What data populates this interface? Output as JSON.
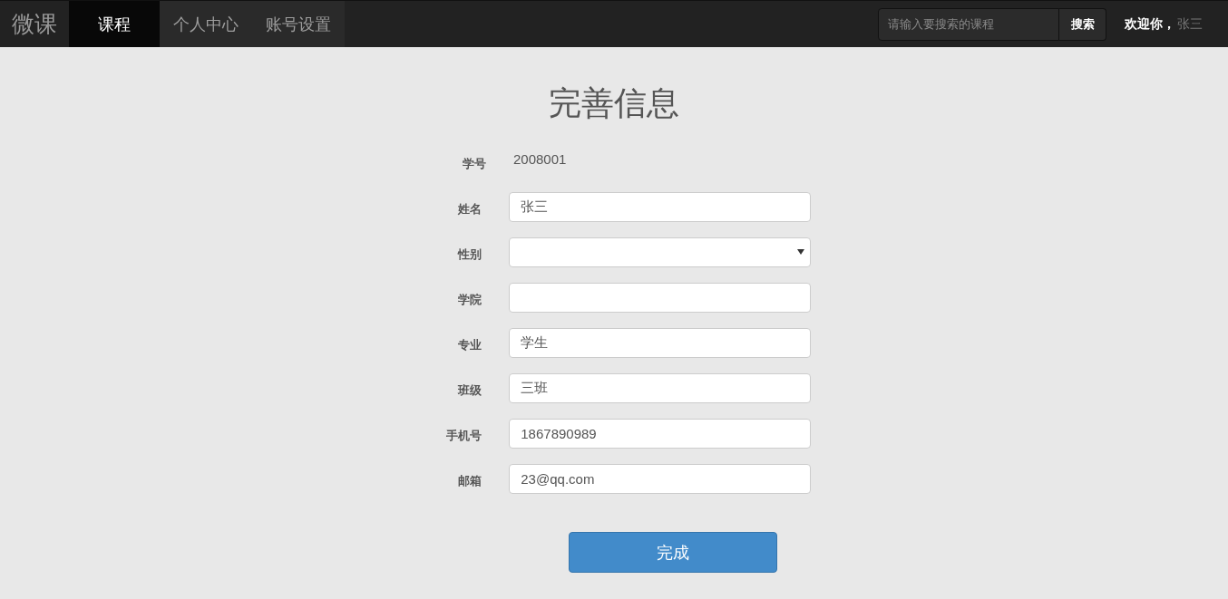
{
  "navbar": {
    "brand": "微课",
    "tabs": [
      {
        "label": "课程",
        "selected": true
      },
      {
        "label": "个人中心",
        "selected": false
      },
      {
        "label": "账号设置",
        "selected": false
      }
    ],
    "search": {
      "placeholder": "请输入要搜索的课程",
      "button": "搜索"
    },
    "welcome": {
      "greeting": "欢迎你，",
      "user": "张三"
    }
  },
  "form": {
    "title": "完善信息",
    "fields": [
      {
        "kind": "static",
        "label": "学号",
        "value": "2008001"
      },
      {
        "kind": "input",
        "label": "姓名",
        "value": "张三"
      },
      {
        "kind": "select",
        "label": "性别"
      },
      {
        "kind": "input",
        "label": "学院"
      },
      {
        "kind": "input",
        "label": "专业",
        "value": "学生"
      },
      {
        "kind": "input",
        "label": "班级",
        "value": "三班"
      },
      {
        "kind": "input",
        "label": "手机号",
        "value": "1867890989"
      },
      {
        "kind": "input",
        "label": "邮箱",
        "value": "23@qq.com"
      }
    ],
    "submit": "完成"
  }
}
